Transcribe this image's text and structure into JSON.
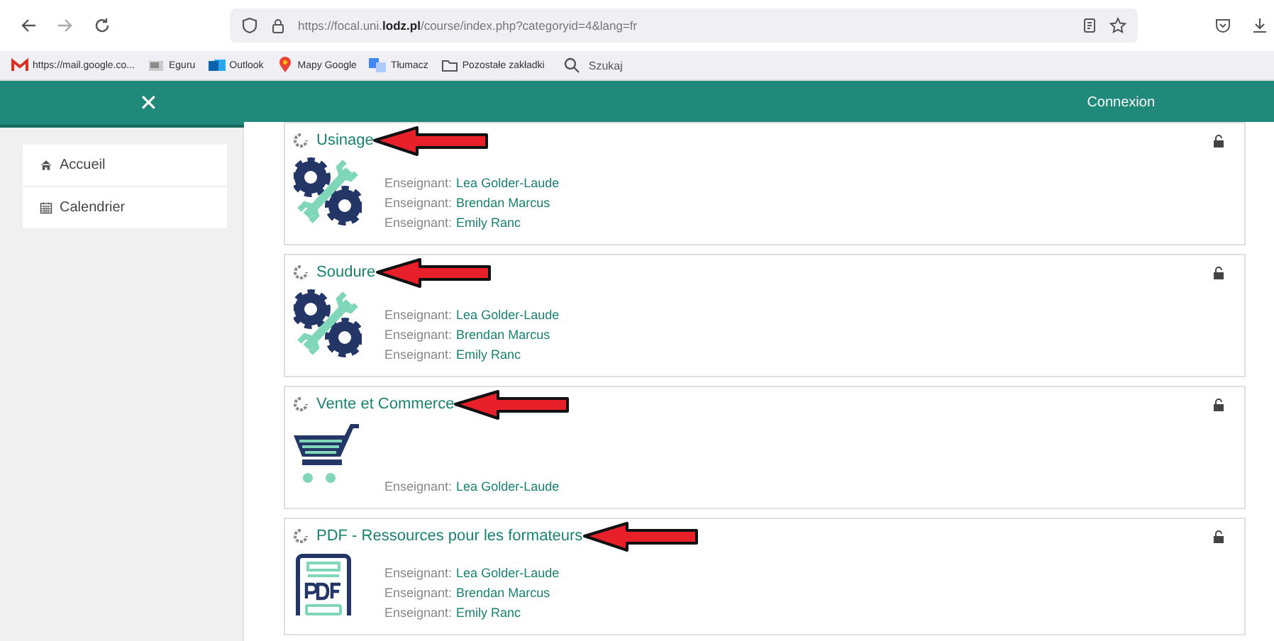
{
  "browser": {
    "url": "https://focal.uni.**lodz.pl**/course/index.php?categoryid=4&lang=fr",
    "bookmarks": [
      {
        "kind": "mail",
        "label": "https://mail.google.co..."
      },
      {
        "kind": "page",
        "label": "Eguru"
      },
      {
        "kind": "outlook",
        "label": "Outlook"
      },
      {
        "kind": "maps",
        "label": "Mapy Google"
      },
      {
        "kind": "translate",
        "label": "Tłumacz"
      },
      {
        "kind": "folder",
        "label": "Pozostałe zakładki"
      }
    ],
    "search": {
      "placeholder": "Szukaj"
    }
  },
  "header": {
    "close": "✕",
    "login": "Connexion"
  },
  "sidebar": {
    "items": [
      {
        "kind": "home",
        "label": "Accueil"
      },
      {
        "kind": "calendar",
        "label": "Calendrier"
      }
    ]
  },
  "courses": [
    {
      "title": "Usinage",
      "kind": "tools",
      "arrow": true,
      "teachers": [
        {
          "label": "Enseignant:",
          "name": "Lea Golder-Laude"
        },
        {
          "label": "Enseignant:",
          "name": "Brendan Marcus"
        },
        {
          "label": "Enseignant:",
          "name": "Emily Ranc"
        }
      ]
    },
    {
      "title": "Soudure",
      "kind": "tools",
      "arrow": true,
      "teachers": [
        {
          "label": "Enseignant:",
          "name": "Lea Golder-Laude"
        },
        {
          "label": "Enseignant:",
          "name": "Brendan Marcus"
        },
        {
          "label": "Enseignant:",
          "name": "Emily Ranc"
        }
      ]
    },
    {
      "title": "Vente et Commerce",
      "kind": "cart",
      "arrow": true,
      "teachers": [
        {
          "label": "Enseignant:",
          "name": "Lea Golder-Laude"
        }
      ]
    },
    {
      "title": "PDF - Ressources pour les formateurs",
      "kind": "pdf",
      "arrow": true,
      "teachers": [
        {
          "label": "Enseignant:",
          "name": "Lea Golder-Laude"
        },
        {
          "label": "Enseignant:",
          "name": "Brendan Marcus"
        },
        {
          "label": "Enseignant:",
          "name": "Emily Ranc"
        }
      ]
    }
  ]
}
